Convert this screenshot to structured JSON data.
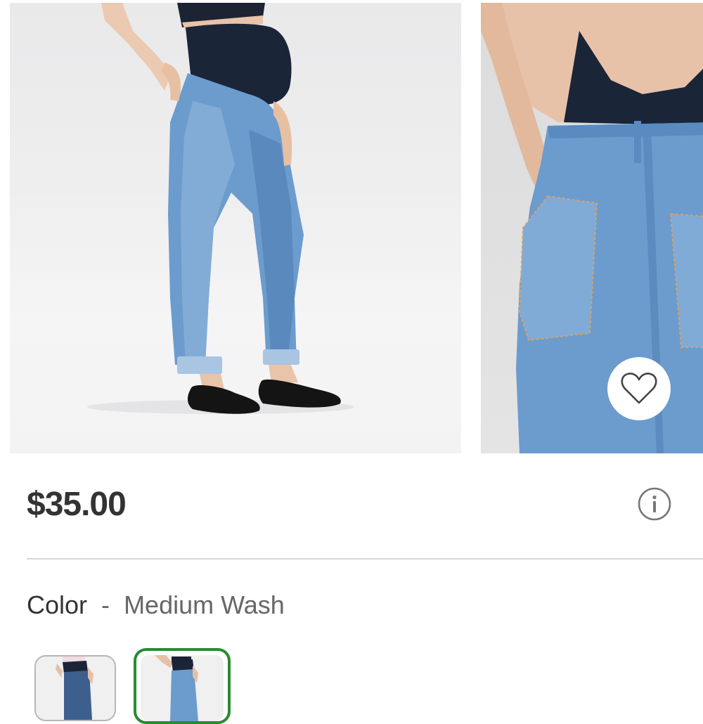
{
  "product": {
    "price": "$35.00",
    "color_label": "Color",
    "color_separator": "-",
    "color_value": "Medium Wash"
  },
  "gallery": {
    "images": [
      {
        "name": "front-view-photo"
      },
      {
        "name": "back-view-photo"
      }
    ],
    "favorite_icon": "heart-icon"
  },
  "info_icon": "info-icon",
  "swatches": [
    {
      "name": "dark-wash",
      "selected": false
    },
    {
      "name": "medium-wash",
      "selected": true
    }
  ],
  "colors": {
    "selected_border": "#2a8a34",
    "denim": "#5f8fc4",
    "band": "#1b2538"
  }
}
